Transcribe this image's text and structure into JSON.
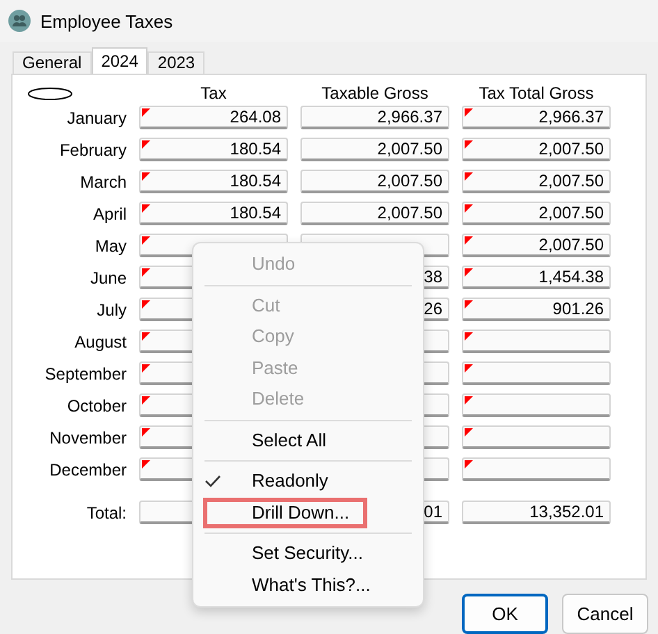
{
  "window": {
    "title": "Employee Taxes"
  },
  "tabs": [
    {
      "label": "General",
      "selected": false
    },
    {
      "label": "2024",
      "selected": true
    },
    {
      "label": "2023",
      "selected": false
    }
  ],
  "columns": [
    "Tax",
    "Taxable Gross",
    "Tax Total Gross"
  ],
  "rows": [
    {
      "label": "January",
      "cells": [
        {
          "value": "264.08",
          "flagged": true
        },
        {
          "value": "2,966.37",
          "flagged": false
        },
        {
          "value": "2,966.37",
          "flagged": true
        }
      ]
    },
    {
      "label": "February",
      "cells": [
        {
          "value": "180.54",
          "flagged": true
        },
        {
          "value": "2,007.50",
          "flagged": false
        },
        {
          "value": "2,007.50",
          "flagged": true
        }
      ]
    },
    {
      "label": "March",
      "cells": [
        {
          "value": "180.54",
          "flagged": true
        },
        {
          "value": "2,007.50",
          "flagged": false
        },
        {
          "value": "2,007.50",
          "flagged": true
        }
      ]
    },
    {
      "label": "April",
      "cells": [
        {
          "value": "180.54",
          "flagged": true
        },
        {
          "value": "2,007.50",
          "flagged": false
        },
        {
          "value": "2,007.50",
          "flagged": true
        }
      ]
    },
    {
      "label": "May",
      "cells": [
        {
          "flagged": true
        },
        {
          "flagged": false
        },
        {
          "value": "2,007.50",
          "flagged": true
        }
      ]
    },
    {
      "label": "June",
      "cells": [
        {
          "flagged": true
        },
        {
          "value": "38",
          "flagged": false
        },
        {
          "value": "1,454.38",
          "flagged": true
        }
      ]
    },
    {
      "label": "July",
      "cells": [
        {
          "flagged": true
        },
        {
          "value": "26",
          "flagged": false
        },
        {
          "value": "901.26",
          "flagged": true
        }
      ]
    },
    {
      "label": "August",
      "cells": [
        {
          "flagged": true
        },
        {
          "flagged": false
        },
        {
          "flagged": true
        }
      ]
    },
    {
      "label": "September",
      "cells": [
        {
          "flagged": true
        },
        {
          "flagged": false
        },
        {
          "flagged": true
        }
      ]
    },
    {
      "label": "October",
      "cells": [
        {
          "flagged": true
        },
        {
          "flagged": false
        },
        {
          "flagged": true
        }
      ]
    },
    {
      "label": "November",
      "cells": [
        {
          "flagged": true
        },
        {
          "flagged": false
        },
        {
          "flagged": true
        }
      ]
    },
    {
      "label": "December",
      "cells": [
        {
          "flagged": true
        },
        {
          "flagged": false
        },
        {
          "flagged": true
        }
      ]
    }
  ],
  "total": {
    "label": "Total:",
    "cells": [
      {
        "flagged": false
      },
      {
        "value": "01",
        "flagged": false
      },
      {
        "value": "13,352.01",
        "flagged": false
      }
    ]
  },
  "context_menu": [
    {
      "kind": "item",
      "label": "Undo",
      "disabled": true,
      "checked": false,
      "highlighted": false
    },
    {
      "kind": "separator"
    },
    {
      "kind": "item",
      "label": "Cut",
      "disabled": true,
      "checked": false,
      "highlighted": false
    },
    {
      "kind": "item",
      "label": "Copy",
      "disabled": true,
      "checked": false,
      "highlighted": false
    },
    {
      "kind": "item",
      "label": "Paste",
      "disabled": true,
      "checked": false,
      "highlighted": false
    },
    {
      "kind": "item",
      "label": "Delete",
      "disabled": true,
      "checked": false,
      "highlighted": false
    },
    {
      "kind": "separator"
    },
    {
      "kind": "item",
      "label": "Select All",
      "disabled": false,
      "checked": false,
      "highlighted": false
    },
    {
      "kind": "separator"
    },
    {
      "kind": "item",
      "label": "Readonly",
      "disabled": false,
      "checked": true,
      "highlighted": false
    },
    {
      "kind": "item",
      "label": "Drill Down...",
      "disabled": false,
      "checked": false,
      "highlighted": true
    },
    {
      "kind": "separator"
    },
    {
      "kind": "item",
      "label": "Set Security...",
      "disabled": false,
      "checked": false,
      "highlighted": false
    },
    {
      "kind": "item",
      "label": "What's This?...",
      "disabled": false,
      "checked": false,
      "highlighted": false
    }
  ],
  "buttons": [
    {
      "label": "OK",
      "default": true
    },
    {
      "label": "Cancel",
      "default": false
    }
  ]
}
